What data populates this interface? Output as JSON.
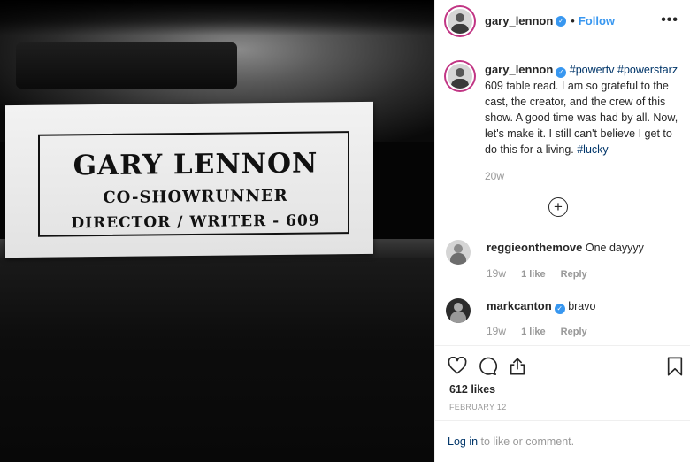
{
  "photo": {
    "card_name": "GARY LENNON",
    "card_role1": "CO-SHOWRUNNER",
    "card_role2": "DIRECTOR / WRITER - 609"
  },
  "header": {
    "username": "gary_lennon",
    "separator": "•",
    "follow_label": "Follow",
    "more_label": "•••"
  },
  "caption": {
    "username": "gary_lennon",
    "hashtag1": "#powertv",
    "hashtag2": "#powerstarz",
    "text": " 609 table read. I am so grateful to the cast, the creator, and the crew of this show. A good time was had by all. Now, let's make it. I still can't believe I get to do this for a living. ",
    "hashtag3": "#lucky",
    "age": "20w"
  },
  "load_more": "+",
  "comments": [
    {
      "username": "reggieonthemove",
      "text": "One dayyyy",
      "age": "19w",
      "likes": "1 like",
      "reply": "Reply",
      "verified": false
    },
    {
      "username": "markcanton",
      "text": "bravo",
      "age": "19w",
      "likes": "1 like",
      "reply": "Reply",
      "verified": true
    }
  ],
  "actions": {
    "likes_label": "612 likes",
    "date": "FEBRUARY 12",
    "login_link": "Log in",
    "login_rest": " to like or comment."
  },
  "colors": {
    "accent": "#3897f0",
    "hashtag": "#003569",
    "muted": "#999999"
  },
  "icons": [
    "heart-icon",
    "comment-icon",
    "share-icon",
    "bookmark-icon",
    "verified-icon",
    "plus-circle-icon"
  ]
}
